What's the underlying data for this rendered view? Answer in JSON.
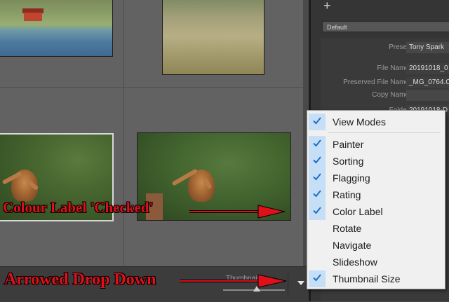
{
  "toolbar": {
    "thumbnails_label": "Thumbnails"
  },
  "panel": {
    "add_icon": "plus-icon",
    "preset_dropdown_value": "Default",
    "metadata": [
      {
        "key": "Preset",
        "value": "Tony Spark"
      },
      {
        "key": "File Name",
        "value": "20191018_0"
      },
      {
        "key": "Preserved File Name",
        "value": "_MG_0764.C"
      },
      {
        "key": "Copy Name",
        "value": ""
      },
      {
        "key": "Folder",
        "value": "20191018-D"
      }
    ]
  },
  "menu": {
    "items": [
      {
        "label": "View Modes",
        "checked": true
      },
      {
        "label": "Painter",
        "checked": true
      },
      {
        "label": "Sorting",
        "checked": true
      },
      {
        "label": "Flagging",
        "checked": true
      },
      {
        "label": "Rating",
        "checked": true
      },
      {
        "label": "Color Label",
        "checked": true
      },
      {
        "label": "Rotate",
        "checked": false
      },
      {
        "label": "Navigate",
        "checked": false
      },
      {
        "label": "Slideshow",
        "checked": false
      },
      {
        "label": "Thumbnail Size",
        "checked": true
      }
    ]
  },
  "annotations": {
    "colour_label": "Colour Label 'Checked'",
    "arrowed_drop_down": "Arrowed Drop Down"
  },
  "colors": {
    "annotation_red": "#e0101a",
    "checked_bg": "#c6dff6",
    "check_blue": "#1f6fc5"
  }
}
